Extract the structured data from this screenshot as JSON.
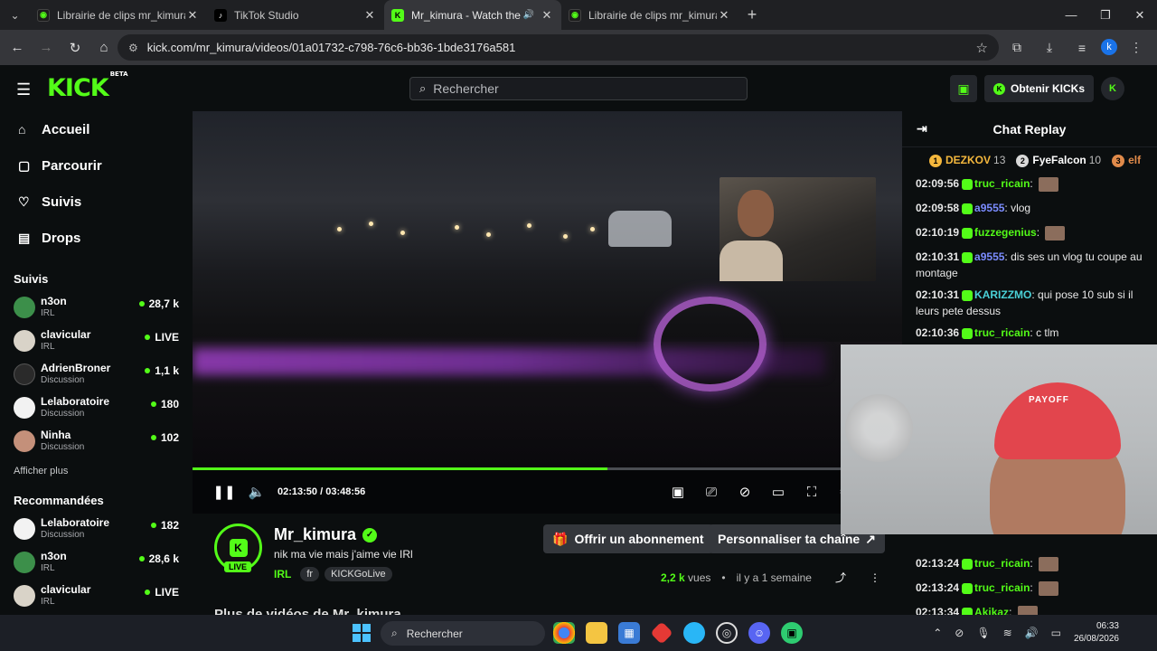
{
  "browser": {
    "tabs": [
      {
        "title": "Librairie de clips mr_kimura | Cl",
        "active": false
      },
      {
        "title": "TikTok Studio",
        "active": false
      },
      {
        "title": "Mr_kimura - Watch the VOD",
        "active": true
      },
      {
        "title": "Librairie de clips mr_kimura | Cl",
        "active": false
      }
    ],
    "url": "kick.com/mr_kimura/videos/01a01732-c798-76c6-bb36-1bde3176a581",
    "profile_initial": "k"
  },
  "header": {
    "logo": "KICK",
    "logo_badge": "BETA",
    "search_placeholder": "Rechercher",
    "kicks_label": "Obtenir KICKs"
  },
  "sidebar": {
    "nav": [
      {
        "label": "Accueil",
        "icon": "home-icon"
      },
      {
        "label": "Parcourir",
        "icon": "browse-icon"
      },
      {
        "label": "Suivis",
        "icon": "heart-icon"
      },
      {
        "label": "Drops",
        "icon": "drops-icon"
      }
    ],
    "following_title": "Suivis",
    "following": [
      {
        "name": "n3on",
        "category": "IRL",
        "viewers": "28,7 k"
      },
      {
        "name": "clavicular",
        "category": "IRL",
        "viewers": "LIVE"
      },
      {
        "name": "AdrienBroner",
        "category": "Discussion",
        "viewers": "1,1 k"
      },
      {
        "name": "Lelaboratoire",
        "category": "Discussion",
        "viewers": "180"
      },
      {
        "name": "Ninha",
        "category": "Discussion",
        "viewers": "102"
      }
    ],
    "show_more": "Afficher plus",
    "recommended_title": "Recommandées",
    "recommended": [
      {
        "name": "Lelaboratoire",
        "category": "Discussion",
        "viewers": "182"
      },
      {
        "name": "n3on",
        "category": "IRL",
        "viewers": "28,6 k"
      },
      {
        "name": "clavicular",
        "category": "IRL",
        "viewers": "LIVE"
      }
    ]
  },
  "player": {
    "current_time": "02:13:50",
    "separator": "/",
    "duration": "03:48:56",
    "progress_fraction": 0.585
  },
  "video_info": {
    "channel": "Mr_kimura",
    "live_badge": "LIVE",
    "title": "nik ma vie mais j'aime vie IRl",
    "category": "IRL",
    "tags": [
      "fr",
      "KICKGoLive"
    ],
    "subscribe_label": "Offrir un abonnement",
    "customize_label": "Personnaliser ta chaîne",
    "views": "2,2 k",
    "views_label": "vues",
    "age": "il y a 1 semaine",
    "more_videos": "Plus de vidéos de Mr_kimura"
  },
  "chat": {
    "title": "Chat Replay",
    "leaderboard": [
      {
        "rank": "1",
        "name": "DEZKOV",
        "score": "13",
        "color": "#f5b83d"
      },
      {
        "rank": "2",
        "name": "FyeFalcon",
        "score": "10",
        "color": "#d9d9d9"
      },
      {
        "rank": "3",
        "name": "elf",
        "score": "",
        "color": "#e08a4a"
      }
    ],
    "messages": [
      {
        "time": "02:09:56",
        "user": "truc_ricain",
        "color": "#53fc18",
        "text": ""
      },
      {
        "time": "02:09:58",
        "user": "a9555",
        "color": "#7b8cff",
        "text": "vlog"
      },
      {
        "time": "02:10:19",
        "user": "fuzzegenius",
        "color": "#53fc18",
        "text": ""
      },
      {
        "time": "02:10:31",
        "user": "a9555",
        "color": "#7b8cff",
        "text": "dis ses un vlog tu coupe au montage"
      },
      {
        "time": "02:10:31",
        "user": "KARIZZMO",
        "color": "#4ad0d6",
        "text": "qui pose 10 sub si il leurs pete dessus"
      },
      {
        "time": "02:10:36",
        "user": "truc_ricain",
        "color": "#53fc18",
        "text": "c tlm"
      },
      {
        "time": "02:13:24",
        "user": "truc_ricain",
        "color": "#53fc18",
        "text": ""
      },
      {
        "time": "02:13:24",
        "user": "truc_ricain",
        "color": "#53fc18",
        "text": ""
      },
      {
        "time": "02:13:34",
        "user": "Akikaz",
        "color": "#53fc18",
        "text": ""
      }
    ]
  },
  "taskbar": {
    "search_placeholder": "Rechercher",
    "time": "06:33",
    "date": "26/08/2026"
  }
}
